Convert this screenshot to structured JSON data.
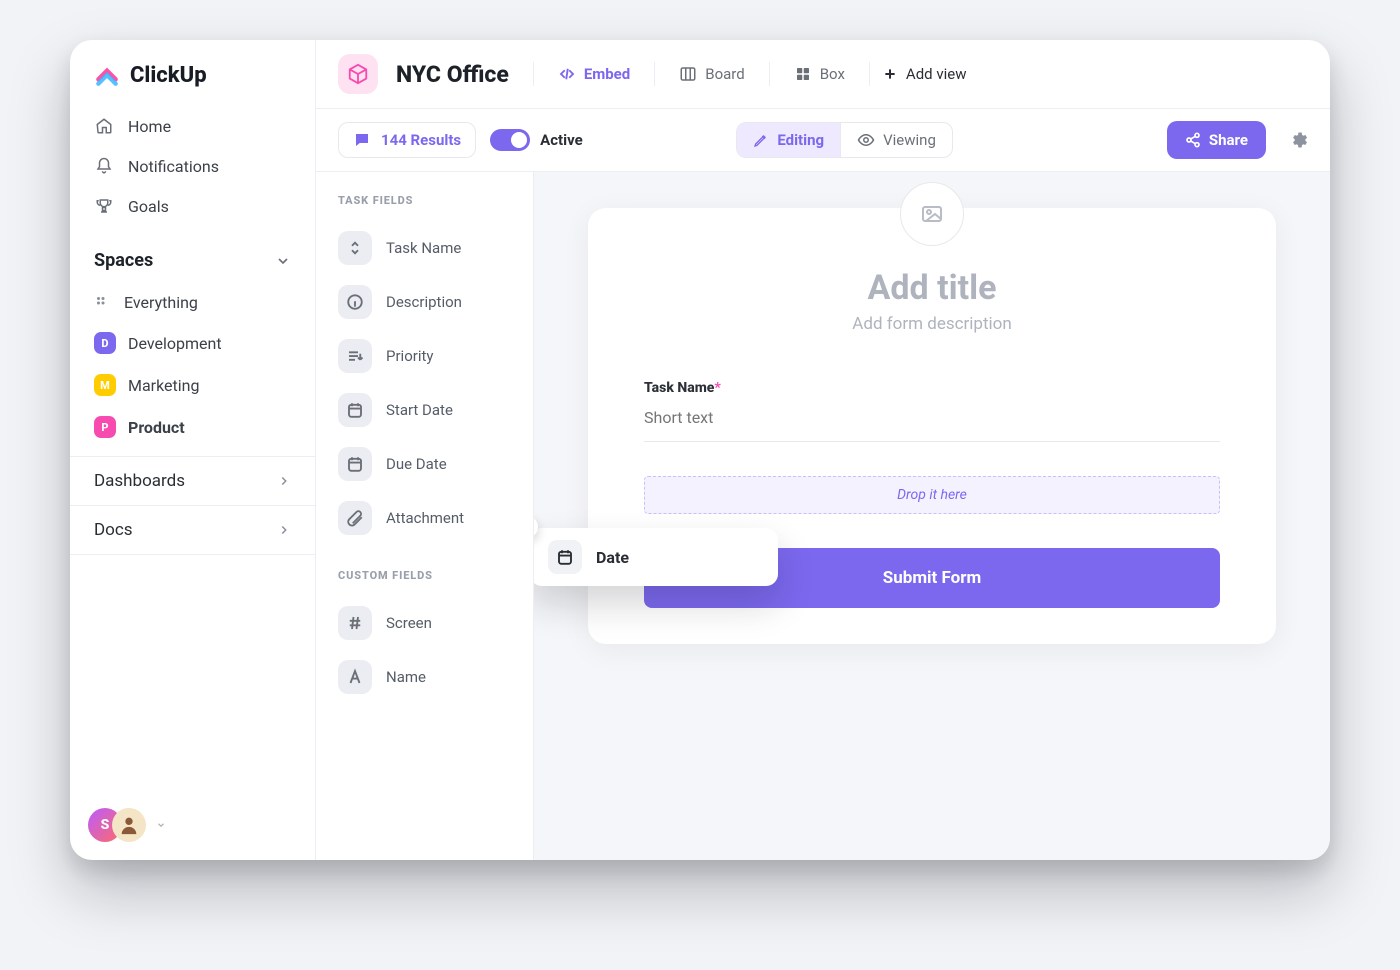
{
  "brand": {
    "name": "ClickUp"
  },
  "nav": {
    "home": "Home",
    "notifications": "Notifications",
    "goals": "Goals"
  },
  "spaces": {
    "header": "Spaces",
    "items": [
      {
        "label": "Everything"
      },
      {
        "letter": "D",
        "label": "Development",
        "color": "#7b68ee"
      },
      {
        "letter": "M",
        "label": "Marketing",
        "color": "#ffcc00"
      },
      {
        "letter": "P",
        "label": "Product",
        "color": "#f84bb0",
        "active": true
      }
    ]
  },
  "side_sections": {
    "dashboards": "Dashboards",
    "docs": "Docs"
  },
  "footer": {
    "avatar_letter": "S"
  },
  "header": {
    "title": "NYC Office",
    "views": {
      "embed": "Embed",
      "board": "Board",
      "box": "Box",
      "add": "Add view"
    }
  },
  "toolbar": {
    "results_count": "144 Results",
    "active_label": "Active",
    "editing": "Editing",
    "viewing": "Viewing",
    "share": "Share"
  },
  "panel": {
    "task_heading": "TASK FIELDS",
    "task_fields": [
      {
        "id": "task-name",
        "label": "Task Name"
      },
      {
        "id": "description",
        "label": "Description"
      },
      {
        "id": "priority",
        "label": "Priority"
      },
      {
        "id": "start-date",
        "label": "Start Date"
      },
      {
        "id": "due-date",
        "label": "Due Date"
      },
      {
        "id": "attachment",
        "label": "Attachment"
      }
    ],
    "custom_heading": "CUSTOM FIELDS",
    "custom_fields": [
      {
        "id": "screen",
        "label": "Screen"
      },
      {
        "id": "name",
        "label": "Name"
      }
    ]
  },
  "drag_chip": {
    "label": "Date"
  },
  "form": {
    "title_placeholder": "Add title",
    "subtitle_placeholder": "Add form description",
    "field_label": "Task Name",
    "field_required": "*",
    "field_placeholder": "Short text",
    "dropzone": "Drop it here",
    "submit": "Submit Form"
  }
}
